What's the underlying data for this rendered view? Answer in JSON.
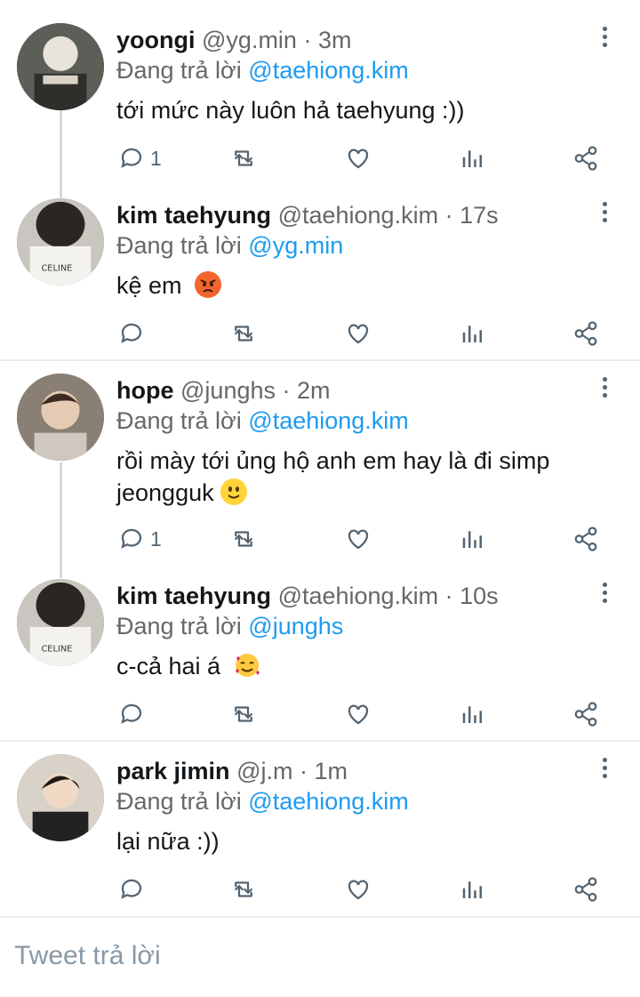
{
  "tweets": [
    {
      "name": "yoongi",
      "handle": "@yg.min",
      "dot": "·",
      "time": "3m",
      "replying_prefix": "Đang trả lời",
      "replying_to": "@taehiong.kim",
      "text": "tới mức này luôn hả taehyung :))",
      "text2": "",
      "reply_count": "1",
      "emoji": ""
    },
    {
      "name": "kim taehyung",
      "handle": "@taehiong.kim",
      "dot": "·",
      "time": "17s",
      "replying_prefix": "Đang trả lời",
      "replying_to": "@yg.min",
      "text": "kệ em",
      "text2": "",
      "reply_count": "",
      "emoji": "angry-face"
    },
    {
      "name": "hope",
      "handle": "@junghs",
      "dot": "·",
      "time": "2m",
      "replying_prefix": "Đang trả lời",
      "replying_to": "@taehiong.kim",
      "text": "rồi mày tới ủng hộ anh em hay là đi simp",
      "text2": "jeongguk",
      "reply_count": "1",
      "emoji": "slightly-smiling-face"
    },
    {
      "name": "kim taehyung",
      "handle": "@taehiong.kim",
      "dot": "·",
      "time": "10s",
      "replying_prefix": "Đang trả lời",
      "replying_to": "@junghs",
      "text": "c-cả hai á",
      "text2": "",
      "reply_count": "",
      "emoji": "smiling-face-with-hearts"
    },
    {
      "name": "park jimin",
      "handle": "@j.m",
      "dot": "·",
      "time": "1m",
      "replying_prefix": "Đang trả lời",
      "replying_to": "@taehiong.kim",
      "text": "lại nữa :))",
      "text2": "",
      "reply_count": "",
      "emoji": ""
    }
  ],
  "reply_bar": {
    "placeholder": "Tweet trả lời"
  },
  "icons": [
    "comment-icon",
    "retweet-icon",
    "like-icon",
    "analytics-icon",
    "share-icon",
    "more-options-icon"
  ],
  "colors": {
    "mention": "#1d9bf0",
    "secondary_text": "#65676b",
    "divider": "#e6ecf0",
    "icon": "#536471"
  }
}
